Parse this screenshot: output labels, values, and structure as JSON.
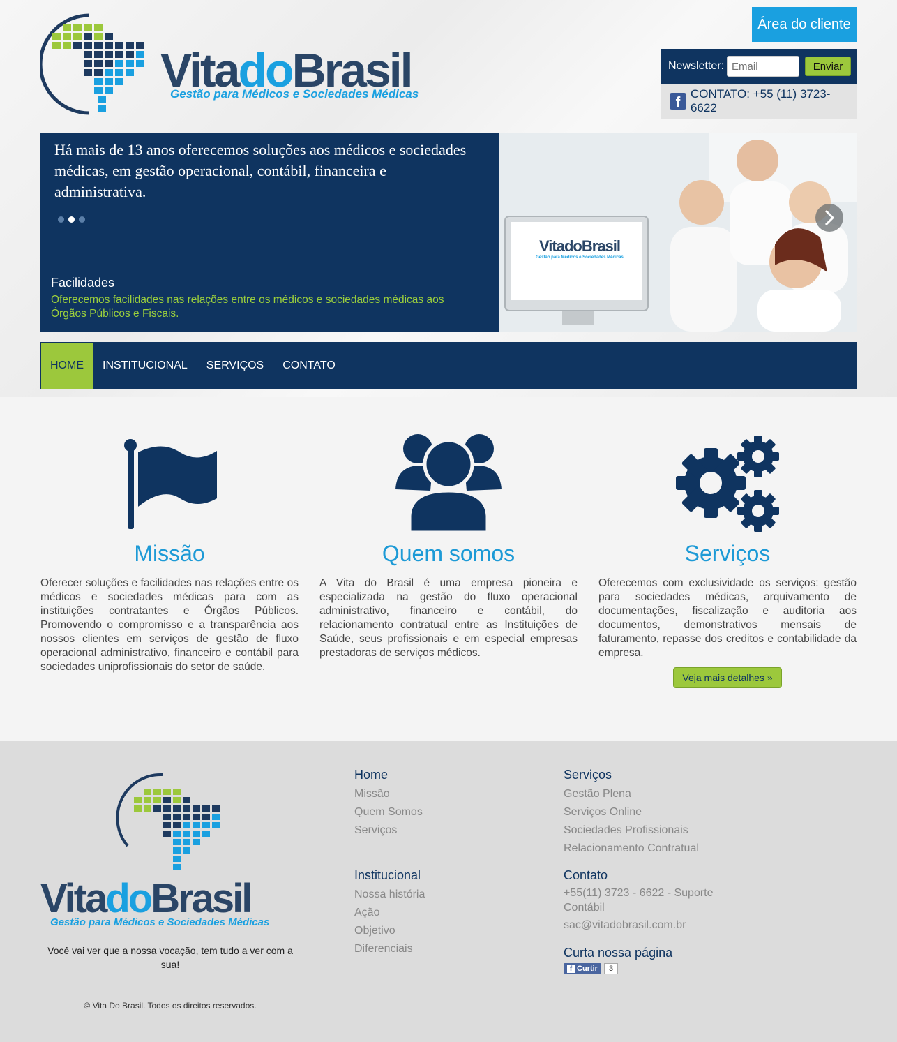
{
  "header": {
    "logo_name": "VitadoBrasil",
    "logo_tagline": "Gestão para Médicos e Sociedades Médicas",
    "area_cliente": "Área do cliente",
    "newsletter_label": "Newsletter:",
    "email_placeholder": "Email",
    "send_label": "Enviar",
    "contact": "CONTATO: +55 (11) 3723-6622"
  },
  "hero": {
    "quote": "Há mais de 13 anos oferecemos soluções aos médicos e sociedades médicas, em gestão operacional, contábil, financeira e administrativa.",
    "slides": 3,
    "active_slide": 2,
    "facilidades_title": "Facilidades",
    "facilidades_text": "Oferecemos facilidades nas relações entre os médicos e sociedades médicas aos Órgãos Públicos e Fiscais.",
    "image_logo": "VitadoBrasil",
    "image_tagline": "Gestão para Médicos e Sociedades Médicas"
  },
  "nav": [
    "HOME",
    "INSTITUCIONAL",
    "SERVIÇOS",
    "CONTATO"
  ],
  "columns": [
    {
      "title": "Missão",
      "icon": "flag-icon",
      "text": "Oferecer soluções e facilidades nas relações entre os médicos e sociedades médicas para com as instituições contratantes e Órgãos Públicos. Promovendo o compromisso e a transparência aos nossos clientes em serviços de gestão de fluxo operacional administrativo, financeiro e contábil para sociedades uniprofissionais do setor de saúde."
    },
    {
      "title": "Quem somos",
      "icon": "users-icon",
      "text": "A Vita do Brasil é uma empresa pioneira e especializada na gestão do fluxo operacional administrativo, financeiro e contábil, do relacionamento contratual entre as Instituições de Saúde, seus profissionais e em especial empresas prestadoras de serviços médicos."
    },
    {
      "title": "Serviços",
      "icon": "gears-icon",
      "text": "Oferecemos com exclusividade os serviços: gestão para sociedades médicas, arquivamento de documentações, fiscalização e auditoria aos documentos, demonstrativos mensais de faturamento, repasse dos creditos e contabilidade da empresa.",
      "button": "Veja mais detalhes »"
    }
  ],
  "footer": {
    "tagline": "Você vai ver que a nossa vocação, tem tudo a ver com a sua!",
    "copyright": "© Vita Do Brasil. Todos os direitos reservados.",
    "home": {
      "title": "Home",
      "links": [
        "Missão",
        "Quem Somos",
        "Serviços"
      ]
    },
    "institucional": {
      "title": "Institucional",
      "links": [
        "Nossa história",
        "Ação",
        "Objetivo",
        "Diferenciais"
      ]
    },
    "servicos": {
      "title": "Serviços",
      "links": [
        "Gestão Plena",
        "Serviços Online",
        "Sociedades Profissionais",
        "Relacionamento Contratual"
      ]
    },
    "contato": {
      "title": "Contato",
      "phone": "+55(11) 3723 - 6622 - Suporte Contábil",
      "email": "sac@vitadobrasil.com.br"
    },
    "curta": {
      "title": "Curta nossa página",
      "like_label": "Curtir",
      "like_count": "3"
    }
  },
  "colors": {
    "navy": "#0f3460",
    "green": "#9cc83c",
    "blue": "#1d9ad6"
  }
}
